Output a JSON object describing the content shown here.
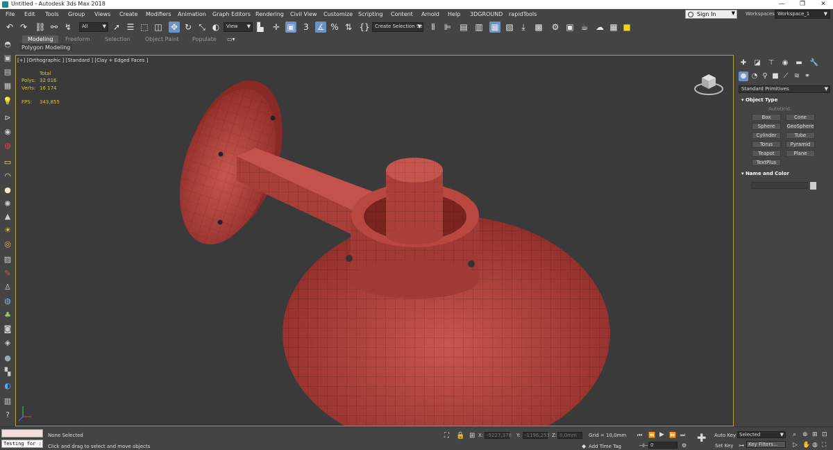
{
  "window": {
    "title": "Untitled - Autodesk 3ds Max 2018",
    "min": "—",
    "max": "❐",
    "close": "✕"
  },
  "menu": [
    "File",
    "Edit",
    "Tools",
    "Group",
    "Views",
    "Create",
    "Modifiers",
    "Animation",
    "Graph Editors",
    "Rendering",
    "Civil View",
    "Customize",
    "Scripting",
    "Content",
    "Arnold",
    "Help",
    "3DGROUND",
    "rapidTools"
  ],
  "account": {
    "sign_in": "Sign In",
    "workspaces_label": "Workspaces:",
    "workspace": "Workspace_1"
  },
  "toolbar": {
    "filter": "All",
    "ref_coord": "View",
    "selection_set": "Create Selection Se"
  },
  "ribbon": {
    "tabs": [
      "Modeling",
      "Freeform",
      "Selection",
      "Object Paint",
      "Populate"
    ],
    "sub": "Polygon Modeling"
  },
  "viewport": {
    "label": "[+] [Orthographic ] [Standard ] [Clay + Edged Faces ]",
    "stats": {
      "total": "Total",
      "polys_label": "Polys:",
      "polys": "32 016",
      "verts_label": "Verts:",
      "verts": "16 174",
      "fps_label": "FPS:",
      "fps": "343,855"
    },
    "object_color": "#b23a35"
  },
  "command_panel": {
    "category": "Standard Primitives",
    "object_type": "Object Type",
    "autogrid": "AutoGrid",
    "buttons": [
      "Box",
      "Cone",
      "Sphere",
      "GeoSphere",
      "Cylinder",
      "Tube",
      "Torus",
      "Pyramid",
      "Teapot",
      "Plane",
      "TextPlus"
    ],
    "name_color": "Name and Color"
  },
  "status": {
    "script": "Testing for :",
    "selection": "None Selected",
    "prompt": "Click and drag to select and move objects",
    "x_label": "X:",
    "x": "-5227,378",
    "y_label": "Y:",
    "y": "-1196,253",
    "z_label": "Z:",
    "z": "0,0mm",
    "grid": "Grid = 10,0mm",
    "add_time_tag": "Add Time Tag",
    "auto_key": "Auto Key",
    "set_key": "Set Key",
    "key_mode": "Selected",
    "key_filters": "Key Filters...",
    "frame": "0"
  }
}
